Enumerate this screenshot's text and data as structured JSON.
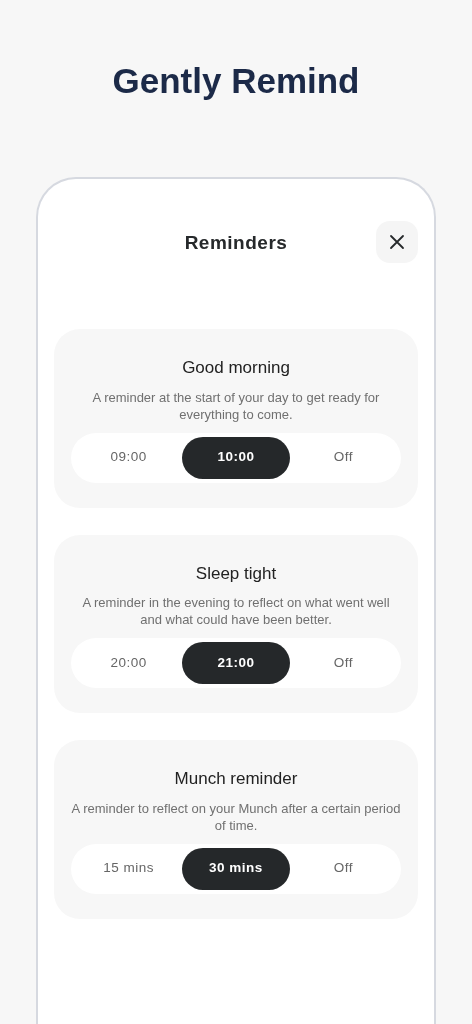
{
  "headline": "Gently Remind",
  "sheet": {
    "title": "Reminders"
  },
  "reminders": [
    {
      "title": "Good morning",
      "description": "A reminder at the start of your day to get ready for everything to come.",
      "options": [
        {
          "label": "09:00",
          "selected": false
        },
        {
          "label": "10:00",
          "selected": true
        },
        {
          "label": "Off",
          "selected": false
        }
      ]
    },
    {
      "title": "Sleep tight",
      "description": "A reminder in the evening to reflect on what went well and what could have been better.",
      "options": [
        {
          "label": "20:00",
          "selected": false
        },
        {
          "label": "21:00",
          "selected": true
        },
        {
          "label": "Off",
          "selected": false
        }
      ]
    },
    {
      "title": "Munch reminder",
      "description": "A reminder to reflect on your Munch after a certain period of time.",
      "options": [
        {
          "label": "15 mins",
          "selected": false
        },
        {
          "label": "30 mins",
          "selected": true
        },
        {
          "label": "Off",
          "selected": false
        }
      ]
    }
  ]
}
